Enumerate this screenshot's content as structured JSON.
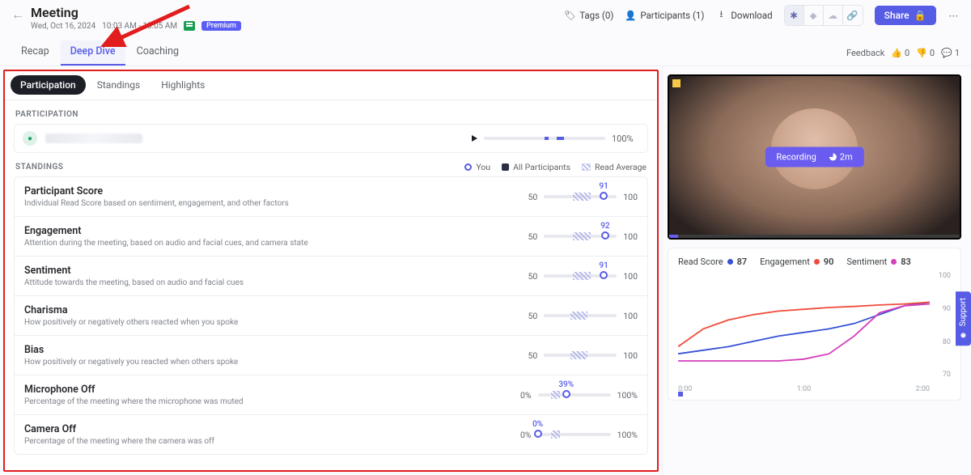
{
  "header": {
    "title": "Meeting",
    "date": "Wed, Oct 16, 2024",
    "time": "10:03 AM - 10:05 AM",
    "premium": "Premium",
    "tags_label": "Tags (0)",
    "participants_label": "Participants (1)",
    "download_label": "Download",
    "share_label": "Share"
  },
  "tabs": {
    "recap": "Recap",
    "deep_dive": "Deep Dive",
    "coaching": "Coaching",
    "active": "deep_dive",
    "feedback_label": "Feedback",
    "thumbs_up": "0",
    "thumbs_down": "0",
    "comments": "1"
  },
  "sub_tabs": {
    "participation": "Participation",
    "standings": "Standings",
    "highlights": "Highlights",
    "active": "participation"
  },
  "participation": {
    "section_label": "PARTICIPATION",
    "pct": "100%"
  },
  "legend": {
    "you": "You",
    "all": "All Participants",
    "avg": "Read Average"
  },
  "standings_label": "STANDINGS",
  "scale": {
    "lo_50": "50",
    "hi_100": "100",
    "lo_0": "0%",
    "hi_100p": "100%"
  },
  "standings": {
    "participant_score": {
      "name": "Participant Score",
      "desc": "Individual Read Score based on sentiment, engagement, and other factors",
      "you": 91,
      "you_label": "91"
    },
    "engagement": {
      "name": "Engagement",
      "desc": "Attention during the meeting, based on audio and facial cues, and camera state",
      "you": 92,
      "you_label": "92"
    },
    "sentiment": {
      "name": "Sentiment",
      "desc": "Attitude towards the meeting, based on audio and facial cues",
      "you": 91,
      "you_label": "91"
    },
    "charisma": {
      "name": "Charisma",
      "desc": "How positively or negatively others reacted when you spoke"
    },
    "bias": {
      "name": "Bias",
      "desc": "How positively or negatively you reacted when others spoke"
    },
    "mic_off": {
      "name": "Microphone Off",
      "desc": "Percentage of the meeting where the microphone was muted",
      "you": 39,
      "you_label": "39%"
    },
    "camera_off": {
      "name": "Camera Off",
      "desc": "Percentage of the meeting where the camera was off",
      "you": 0,
      "you_label": "0%"
    }
  },
  "video": {
    "status": "Recording",
    "duration": "2m"
  },
  "chart_data": {
    "type": "line",
    "title": "",
    "xlabel": "",
    "ylabel": "",
    "ylim": [
      70,
      100
    ],
    "x_ticks": [
      "0:00",
      "1:00",
      "2:00"
    ],
    "series": [
      {
        "name": "Read Score",
        "color": "#3651d4",
        "legend_value": 87,
        "x": [
          0,
          10,
          20,
          30,
          40,
          50,
          60,
          70,
          80,
          90,
          100
        ],
        "y": [
          77,
          78,
          79,
          80.5,
          82,
          83,
          84,
          85.5,
          88,
          90.5,
          91.5
        ]
      },
      {
        "name": "Engagement",
        "color": "#ef4d3c",
        "legend_value": 90,
        "x": [
          0,
          10,
          20,
          30,
          40,
          50,
          60,
          70,
          80,
          90,
          100
        ],
        "y": [
          79,
          84,
          86.5,
          88,
          89,
          89.5,
          90,
          90.3,
          90.7,
          91,
          91.5
        ]
      },
      {
        "name": "Sentiment",
        "color": "#d63fbd",
        "legend_value": 83,
        "x": [
          0,
          10,
          20,
          30,
          40,
          50,
          60,
          70,
          80,
          90,
          100
        ],
        "y": [
          75,
          75,
          75,
          75,
          75,
          75.5,
          77,
          82,
          88.5,
          90.5,
          91
        ]
      }
    ]
  },
  "support": "Support"
}
